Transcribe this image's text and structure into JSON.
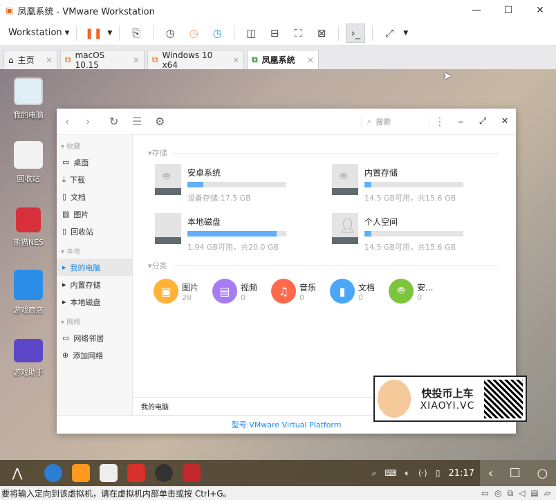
{
  "window": {
    "title": "凤凰系统 - VMware Workstation",
    "min": "—",
    "max": "☐",
    "close": "✕"
  },
  "toolbar": {
    "workstation": "Workstation ▾"
  },
  "tabs": [
    {
      "label": "主页"
    },
    {
      "label": "macOS 10.15"
    },
    {
      "label": "Windows 10 x64"
    },
    {
      "label": "凤凰系统"
    }
  ],
  "desktop": [
    {
      "label": "我的电脑",
      "color": "#dfeef7"
    },
    {
      "label": "回收站",
      "color": "#f2f2f2"
    },
    {
      "label": "熊猫NES",
      "color": "#d8303a"
    },
    {
      "label": "游戏商店",
      "color": "#2b8de8"
    },
    {
      "label": "游戏助手",
      "color": "#5b47c8"
    }
  ],
  "fm": {
    "search": "搜索",
    "sidebar": {
      "h1": "收藏",
      "fav": [
        "桌面",
        "下载",
        "文档",
        "图片",
        "回收站"
      ],
      "h2": "本地",
      "local": [
        "我的电脑",
        "内置存储",
        "本地磁盘"
      ],
      "h3": "网络",
      "net": [
        "网络邻居",
        "添加网络"
      ]
    },
    "storage_title": "存储",
    "drives": [
      {
        "name": "安卓系统",
        "sub": "设备存储:17.5 GB",
        "used": 0.16
      },
      {
        "name": "内置存储",
        "sub": "14.5 GB可用，共15.6 GB",
        "used": 0.07
      },
      {
        "name": "本地磁盘",
        "sub": "1.94 GB可用，共20.0 GB",
        "used": 0.9
      },
      {
        "name": "个人空间",
        "sub": "14.5 GB可用，共15.6 GB",
        "used": 0.07
      }
    ],
    "category_title": "分类",
    "categories": [
      {
        "name": "图片",
        "count": "28",
        "color": "#ffb236"
      },
      {
        "name": "视频",
        "count": "0",
        "color": "#a77cf0"
      },
      {
        "name": "音乐",
        "count": "0",
        "color": "#ff6a4d"
      },
      {
        "name": "文档",
        "count": "0",
        "color": "#4aa8f7"
      },
      {
        "name": "安...",
        "count": "0",
        "color": "#7cc53c"
      }
    ],
    "breadcrumb": "我的电脑",
    "footer": "型号:VMware Virtual Platform"
  },
  "ad": {
    "text1": "快投币上车",
    "text2": "XIAOYI.VC"
  },
  "taskbar": {
    "time": "21:17"
  },
  "statusbar": "要将输入定向到该虚拟机，请在虚拟机内部单击或按 Ctrl+G。"
}
